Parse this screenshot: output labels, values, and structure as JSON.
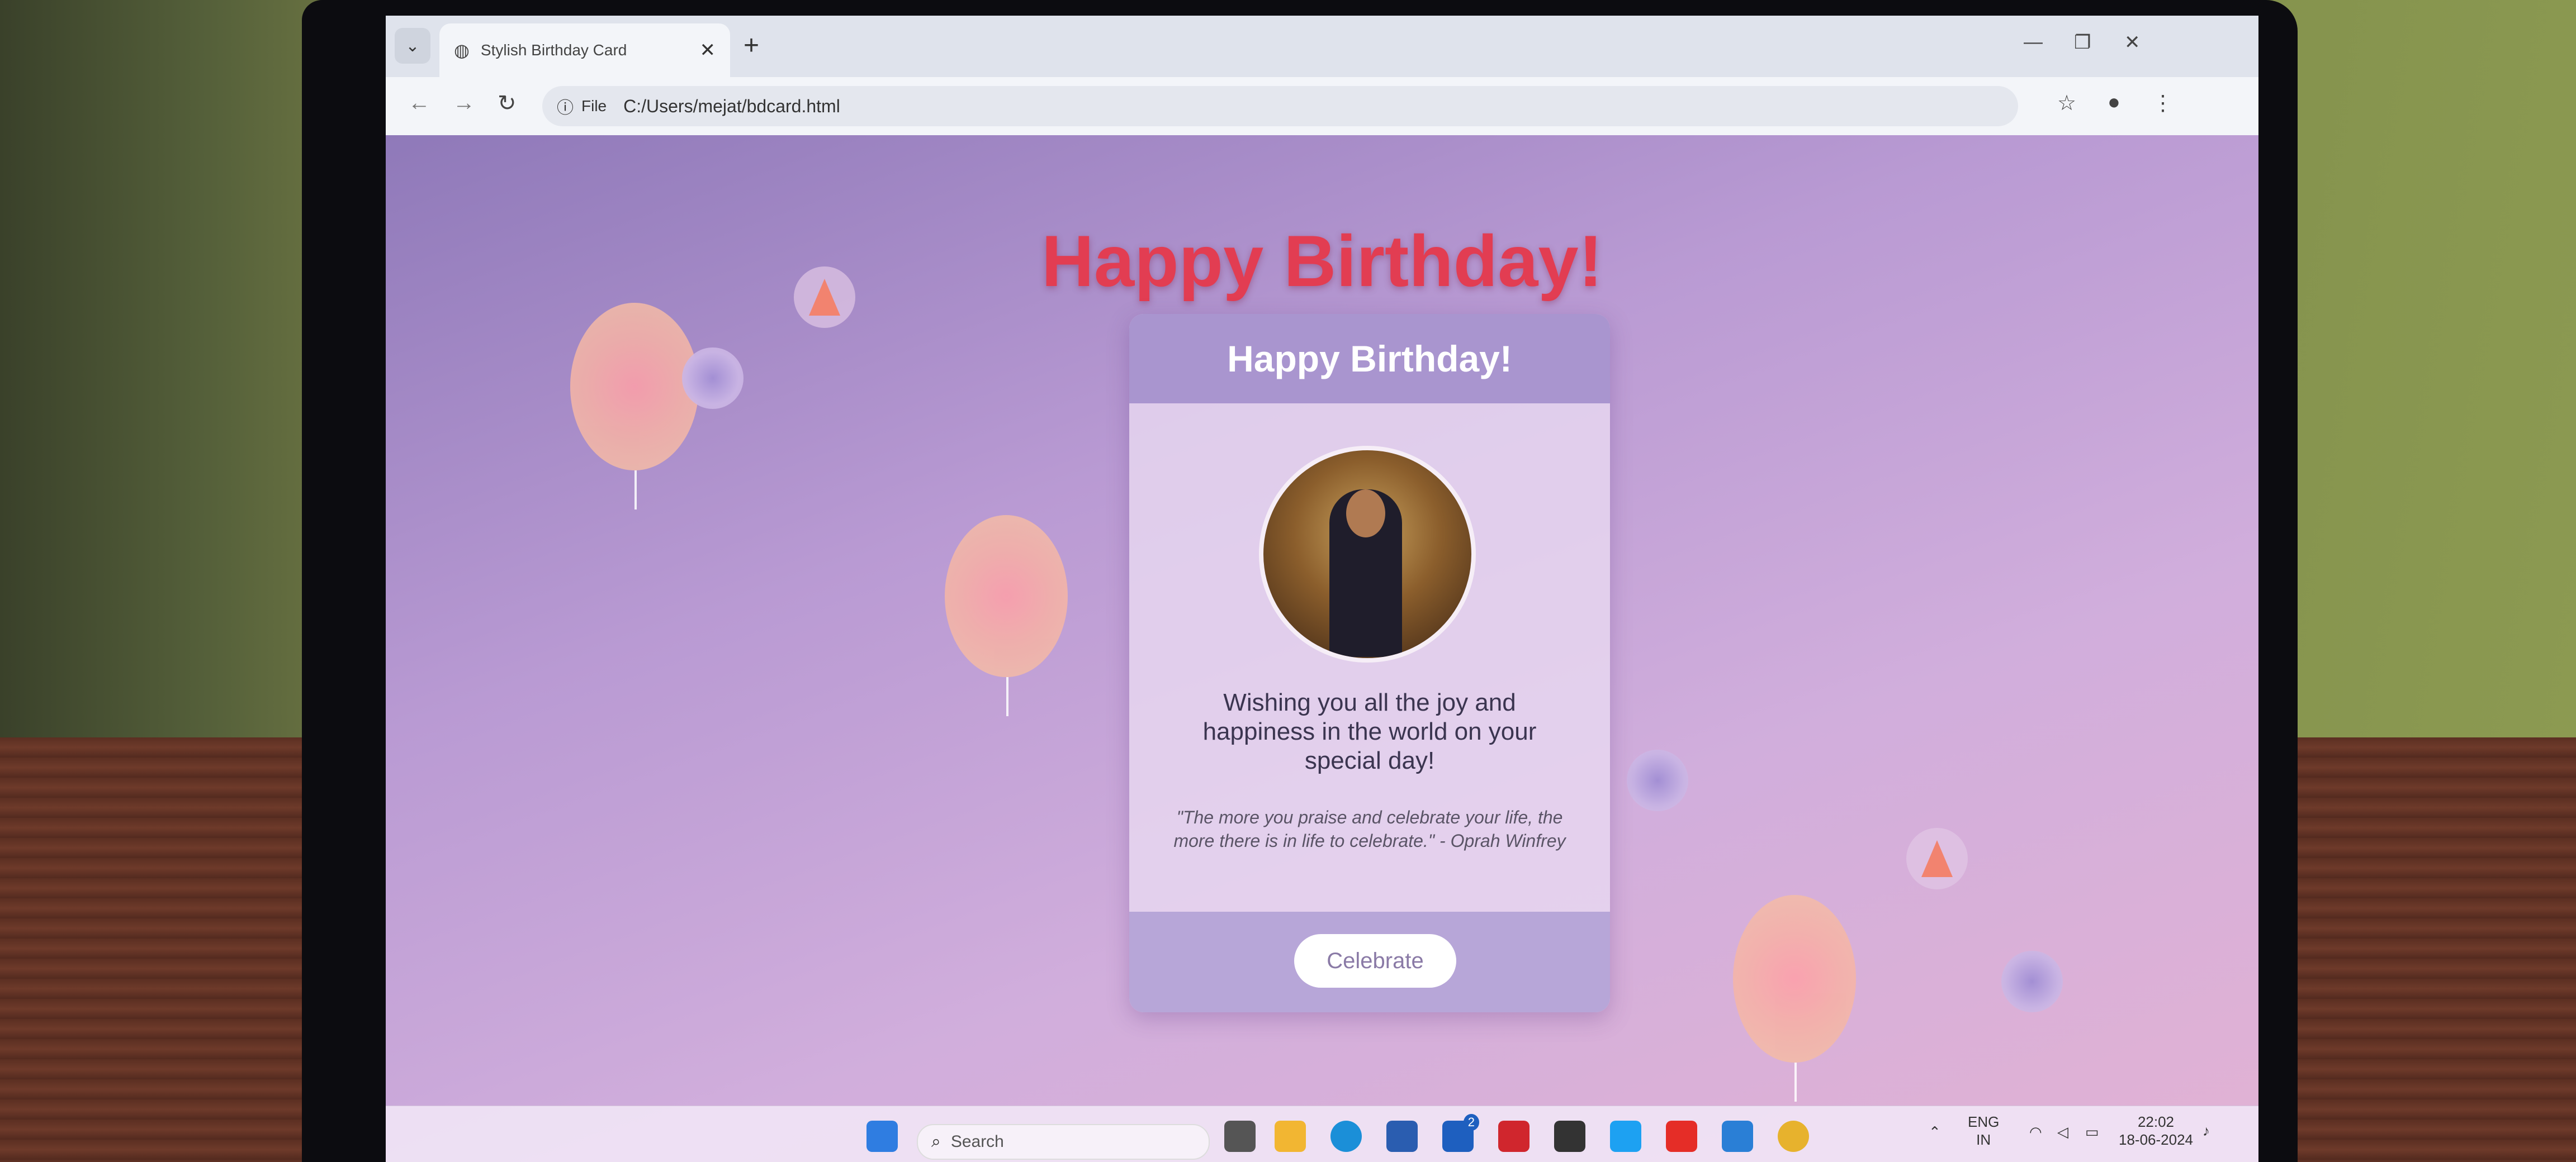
{
  "browser": {
    "tab_title": "Stylish Birthday Card",
    "new_tab_symbol": "+",
    "omnibox": {
      "scheme_label": "File",
      "url": "C:/Users/mejat/bdcard.html"
    }
  },
  "page": {
    "heading": "Happy Birthday!",
    "card": {
      "header": "Happy Birthday!",
      "message": "Wishing you all the joy and happiness in the world on your special day!",
      "quote": "\"The more you praise and celebrate your life, the more there is in life to celebrate.\" - Oprah Winfrey",
      "button_label": "Celebrate"
    }
  },
  "taskbar": {
    "search_placeholder": "Search",
    "language": "ENG",
    "region": "IN",
    "time": "22:02",
    "date": "18-06-2024",
    "badge_count": "2"
  },
  "colors": {
    "title_red": "#e23d52",
    "card_header": "#a995cf",
    "page_bg_start": "#8f79b9",
    "page_bg_end": "#e2b2d4"
  }
}
